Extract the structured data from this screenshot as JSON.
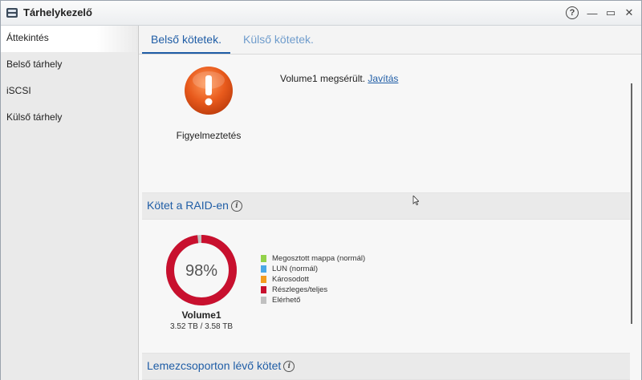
{
  "window": {
    "title": "Tárhelykezelő"
  },
  "titlebar": {
    "help_glyph": "?",
    "minimize_glyph": "—",
    "maximize_glyph": "▭",
    "close_glyph": "✕"
  },
  "sidebar": {
    "items": [
      {
        "label": "Áttekintés",
        "active": true
      },
      {
        "label": "Belső tárhely",
        "active": false
      },
      {
        "label": "iSCSI",
        "active": false
      },
      {
        "label": "Külső tárhely",
        "active": false
      }
    ]
  },
  "tabs": [
    {
      "label": "Belső kötetek.",
      "active": true
    },
    {
      "label": "Külső kötetek.",
      "active": false
    }
  ],
  "status": {
    "icon": "warning-icon",
    "label": "Figyelmeztetés",
    "message": "Volume1 megsérült. ",
    "link": "Javítás"
  },
  "raid_section": {
    "title": "Kötet a RAID-en"
  },
  "disk_section": {
    "title": "Lemezcsoporton lévő kötet"
  },
  "volume": {
    "name": "Volume1",
    "usage_percent": 98,
    "percent_label": "98%",
    "size_text": "3.52 TB / 3.58 TB"
  },
  "legend": [
    {
      "label": "Megosztott mappa (normál)",
      "color": "#93d24a"
    },
    {
      "label": "LUN (normál)",
      "color": "#4aa8e6"
    },
    {
      "label": "Károsodott",
      "color": "#f39c1f"
    },
    {
      "label": "Részleges/teljes",
      "color": "#c8102e"
    },
    {
      "label": "Elérhető",
      "color": "#c0c0c0"
    }
  ],
  "colors": {
    "accent": "#1f5da6",
    "donut_used": "#c8102e",
    "donut_free": "#c0c0c0",
    "warning": "#e65a1f"
  }
}
